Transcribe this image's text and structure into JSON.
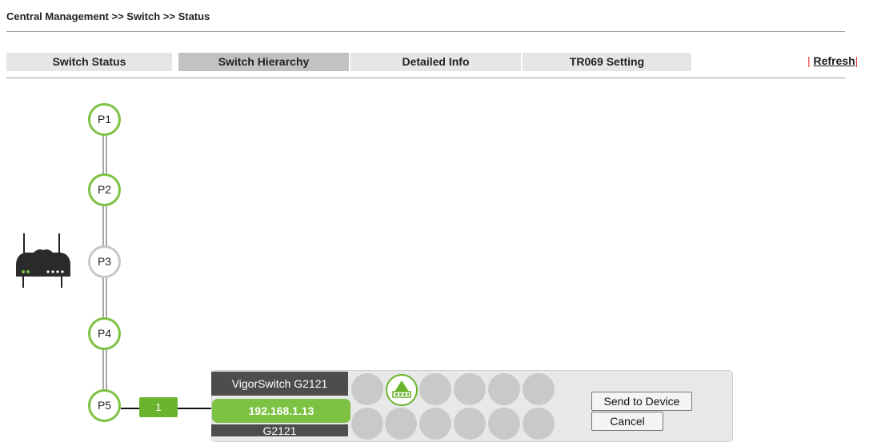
{
  "breadcrumb": "Central Management >> Switch >> Status",
  "tabs": [
    {
      "label": "Switch Status"
    },
    {
      "label": "Switch Hierarchy"
    },
    {
      "label": "Detailed Info"
    },
    {
      "label": "TR069 Setting"
    }
  ],
  "active_tab": "Switch Hierarchy",
  "refresh": {
    "sep_left": "|",
    "label": "Refresh",
    "sep_right": "|"
  },
  "ports": [
    {
      "label": "P1",
      "status": "linked"
    },
    {
      "label": "P2",
      "status": "linked"
    },
    {
      "label": "P3",
      "status": "inactive"
    },
    {
      "label": "P4",
      "status": "linked"
    },
    {
      "label": "P5",
      "status": "linked"
    }
  ],
  "router_icon": "router-icon",
  "link_badge": "1",
  "device": {
    "name": "VigorSwitch G2121",
    "ip": "192.168.1.13",
    "model": "G2121",
    "uplink_icon": "uplink-arrow-icon"
  },
  "buttons": {
    "send": "Send to Device",
    "cancel": "Cancel"
  },
  "colors": {
    "accent_green": "#7dc242",
    "dark_panel": "#4d4d4d",
    "inactive_grey": "#c8c8c8",
    "refresh_sep": "#e23b3b"
  }
}
